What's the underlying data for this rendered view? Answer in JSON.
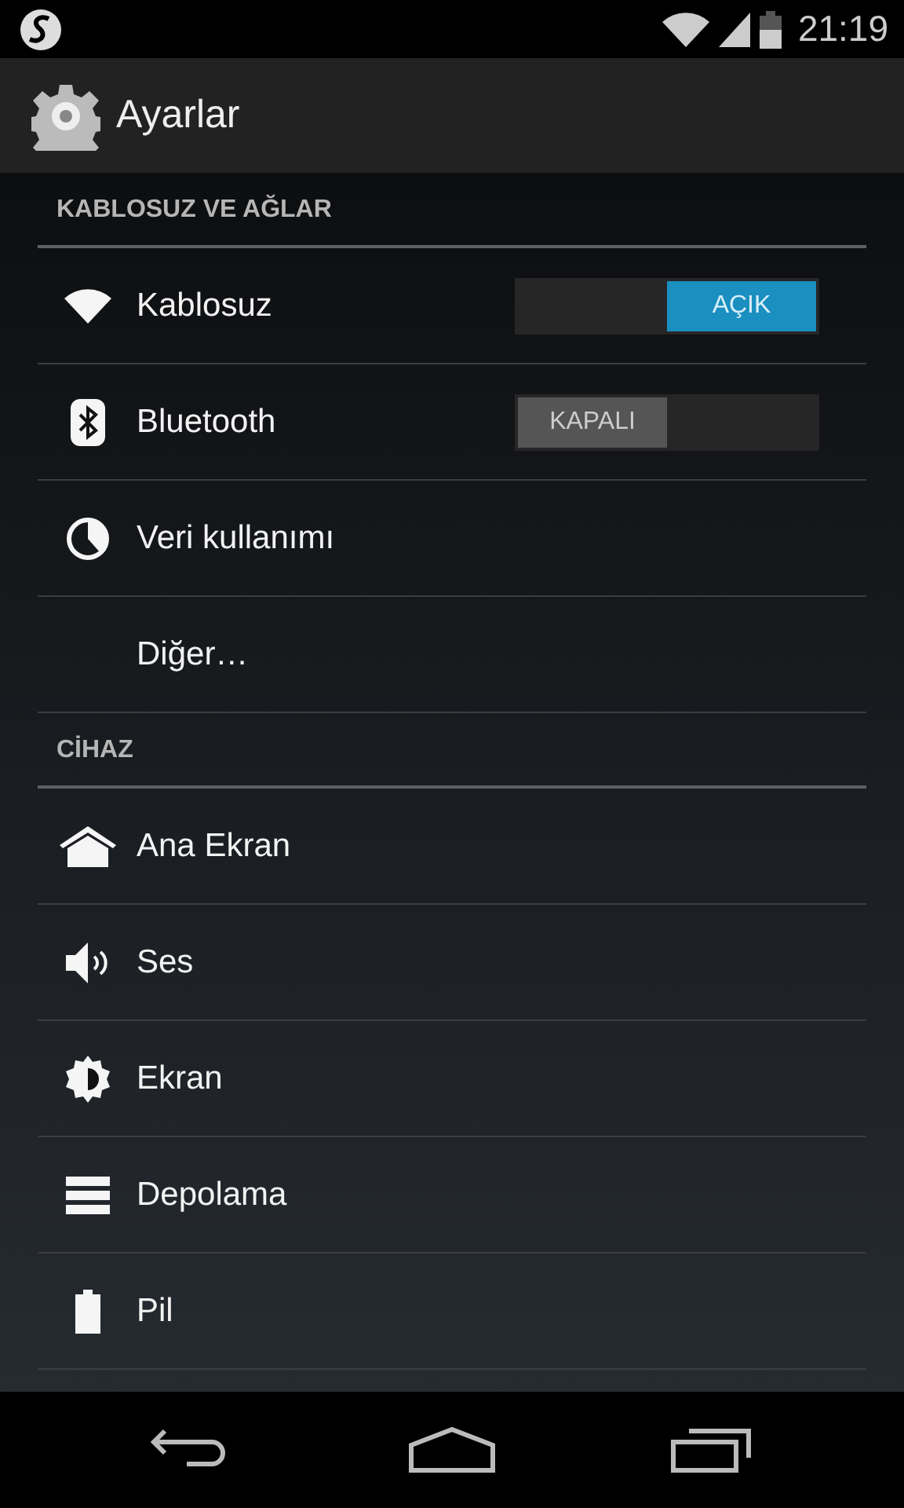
{
  "status_bar": {
    "time": "21:19"
  },
  "action_bar": {
    "title": "Ayarlar"
  },
  "sections": [
    {
      "title": "KABLOSUZ VE AĞLAR",
      "items": [
        {
          "kind": "switch",
          "label": "Kablosuz",
          "on": true,
          "state_label": "AÇIK"
        },
        {
          "kind": "switch",
          "label": "Bluetooth",
          "on": false,
          "state_label": "KAPALI"
        },
        {
          "kind": "plain",
          "label": "Veri kullanımı"
        },
        {
          "kind": "plain",
          "label": "Diğer…"
        }
      ]
    },
    {
      "title": "CİHAZ",
      "items": [
        {
          "kind": "plain",
          "label": "Ana Ekran"
        },
        {
          "kind": "plain",
          "label": "Ses"
        },
        {
          "kind": "plain",
          "label": "Ekran"
        },
        {
          "kind": "plain",
          "label": "Depolama"
        },
        {
          "kind": "plain",
          "label": "Pil"
        }
      ]
    }
  ]
}
